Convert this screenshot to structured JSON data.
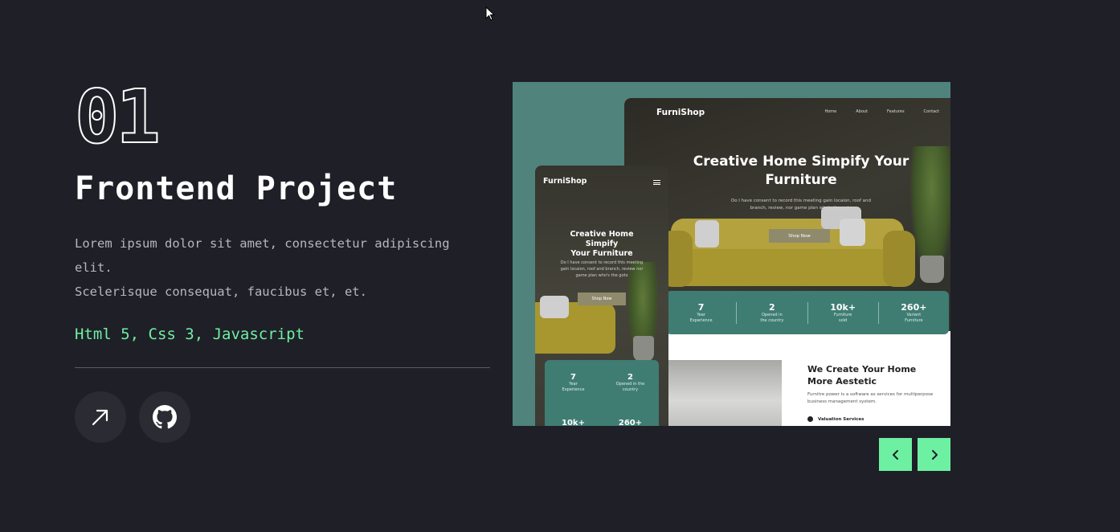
{
  "project": {
    "number": "01",
    "title": "Frontend Project",
    "description_line1": "Lorem ipsum dolor sit amet, consectetur adipiscing elit.",
    "description_line2": "Scelerisque consequat, faucibus et, et.",
    "tech_stack": "Html 5, Css 3, Javascript"
  },
  "links": {
    "live_icon": "arrow-up-right-icon",
    "repo_icon": "github-icon"
  },
  "preview": {
    "desktop": {
      "logo": "FurniShop",
      "nav": [
        "Home",
        "About",
        "Features",
        "Contact"
      ],
      "headline_line1": "Creative Home Simpify Your",
      "headline_line2": "Furniture",
      "paragraph_line1": "Do I have consent to record this meeting gain locaion, roof and",
      "paragraph_line2": "branch, review, nor game plan who's the goto",
      "cta": "Shop Now",
      "stats": [
        {
          "value": "7",
          "label1": "Year",
          "label2": "Experience"
        },
        {
          "value": "2",
          "label1": "Opened in",
          "label2": "the country"
        },
        {
          "value": "10k+",
          "label1": "Furniture",
          "label2": "sold"
        },
        {
          "value": "260+",
          "label1": "Variant",
          "label2": "Furniture"
        }
      ],
      "section_heading_line1": "We Create Your Home",
      "section_heading_line2": "More Aestetic",
      "section_text_line1": "Furnitre power is a software as services for multiperpose",
      "section_text_line2": "business management system.",
      "list_item": "Valuation Services"
    },
    "mobile": {
      "logo": "FurniShop",
      "headline_line1": "Creative Home Simpify",
      "headline_line2": "Your Furniture",
      "paragraph_line1": "Do I have consent to record this meeting",
      "paragraph_line2": "gain locaion, roof and branch, review nor",
      "paragraph_line3": "game plan who's the goto",
      "cta": "Shop Now",
      "stats": [
        {
          "value": "7",
          "label1": "Year",
          "label2": "Experience"
        },
        {
          "value": "2",
          "label1": "Opened in the",
          "label2": "country"
        },
        {
          "value": "10k+",
          "label1": "",
          "label2": ""
        },
        {
          "value": "260+",
          "label1": "",
          "label2": ""
        }
      ]
    }
  },
  "slider": {
    "prev_icon": "chevron-left-icon",
    "next_icon": "chevron-right-icon"
  },
  "colors": {
    "background": "#1f1f27",
    "accent": "#6ef0a2",
    "preview_bg": "#4f837c",
    "stats_bg": "#3f7d73"
  }
}
